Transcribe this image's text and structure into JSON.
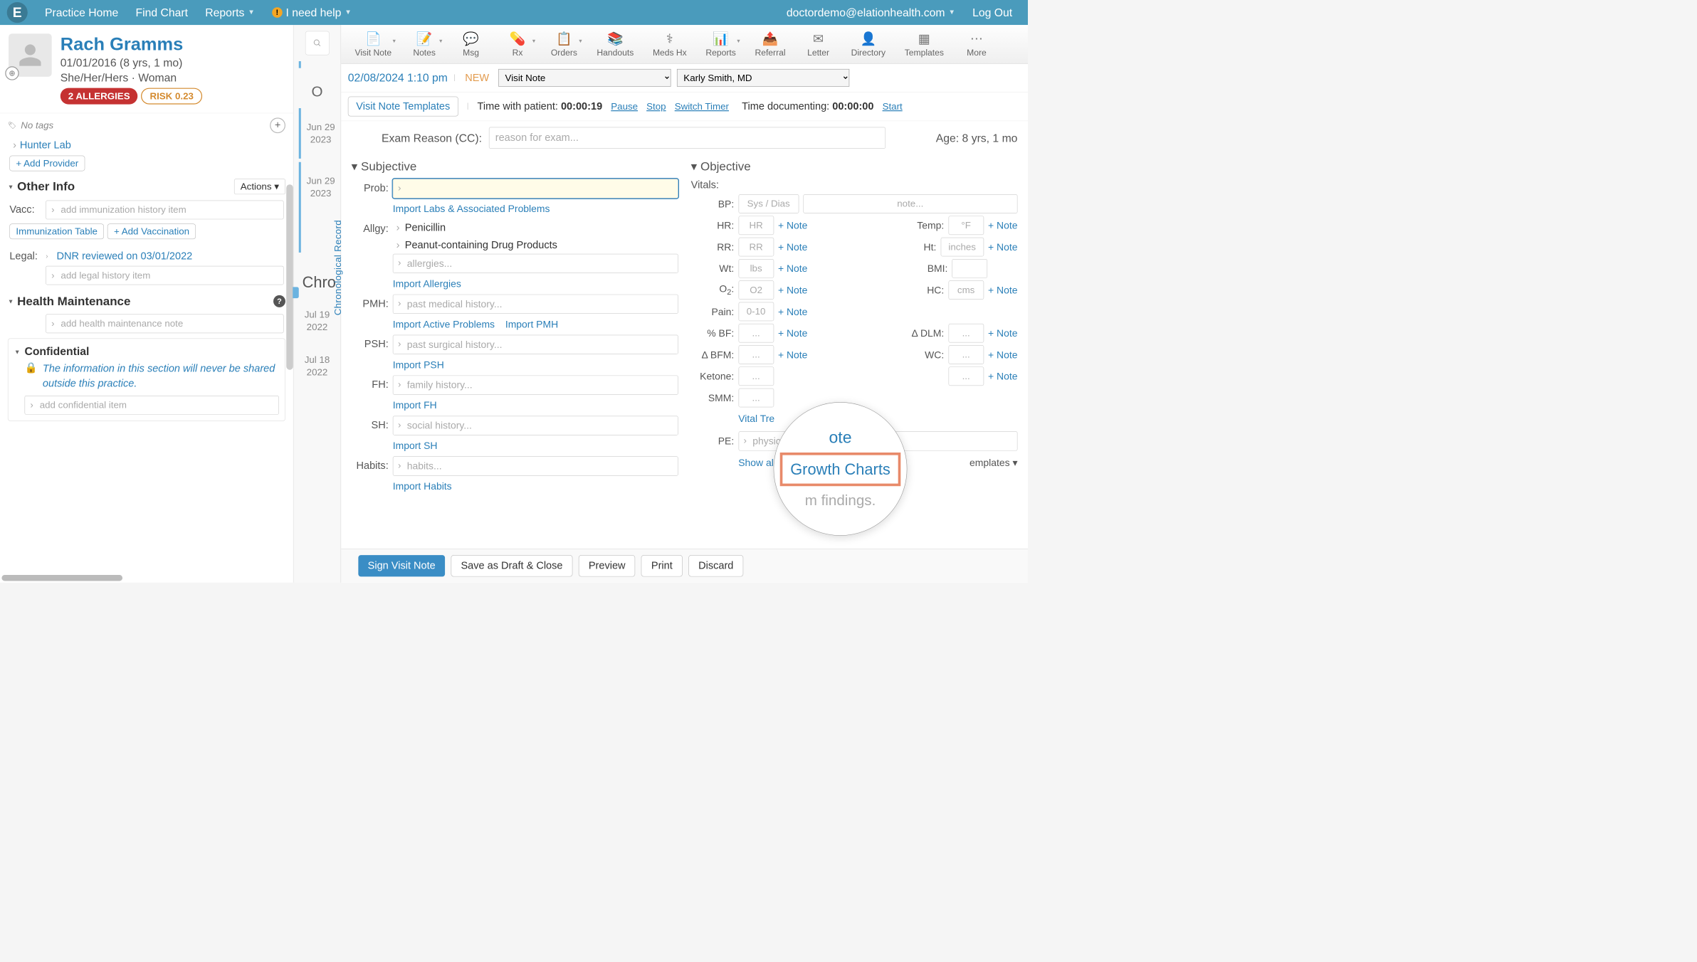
{
  "nav": {
    "practice_home": "Practice Home",
    "find_chart": "Find Chart",
    "reports": "Reports",
    "help": "I need help",
    "user": "doctordemo@elationhealth.com",
    "logout": "Log Out"
  },
  "patient": {
    "name": "Rach Gramms",
    "dob_age": "01/01/2016 (8 yrs, 1 mo)",
    "pronouns": "She/Her/Hers · Woman",
    "allergies_badge": "2 ALLERGIES",
    "risk_badge": "RISK 0.23",
    "no_tags": "No tags"
  },
  "sidebar": {
    "hunter_lab": "Hunter Lab",
    "add_provider": "+ Add Provider",
    "other_info": "Other Info",
    "actions": "Actions",
    "vacc_label": "Vacc:",
    "vacc_placeholder": "add immunization history item",
    "immun_table": "Immunization Table",
    "add_vacc": "+ Add Vaccination",
    "legal_label": "Legal:",
    "dnr": "DNR reviewed on 03/01/2022",
    "legal_placeholder": "add legal history item",
    "health_maint": "Health Maintenance",
    "hm_placeholder": "add health maintenance note",
    "confidential": "Confidential",
    "conf_text": "The information in this section will never be shared outside this practice.",
    "conf_placeholder": "add confidential item"
  },
  "timeline": {
    "header_letter": "O",
    "d1_line1": "Jun 29",
    "d1_line2": "2023",
    "d2_line1": "Jun 29",
    "d2_line2": "2023",
    "chron": "Chro",
    "d3_line1": "Jul 19",
    "d3_line2": "2022",
    "d4_line1": "Jul 18",
    "d4_line2": "2022",
    "vert_label": "Chronological Record"
  },
  "toolbar": {
    "visit_note": "Visit Note",
    "notes": "Notes",
    "msg": "Msg",
    "rx": "Rx",
    "orders": "Orders",
    "handouts": "Handouts",
    "meds_hx": "Meds Hx",
    "reports": "Reports",
    "referral": "Referral",
    "letter": "Letter",
    "directory": "Directory",
    "templates": "Templates",
    "more": "More"
  },
  "note_header": {
    "date": "02/08/2024 1:10 pm",
    "new": "NEW",
    "type": "Visit Note",
    "provider": "Karly Smith, MD",
    "templates_btn": "Visit Note Templates",
    "time_patient_label": "Time with patient:",
    "time_patient_val": "00:00:19",
    "pause": "Pause",
    "stop": "Stop",
    "switch": "Switch Timer",
    "time_doc_label": "Time documenting:",
    "time_doc_val": "00:00:00",
    "start": "Start"
  },
  "exam": {
    "label": "Exam Reason (CC):",
    "placeholder": "reason for exam...",
    "age": "Age: 8 yrs, 1 mo"
  },
  "subjective": {
    "title": "Subjective",
    "prob": "Prob:",
    "import_labs": "Import Labs & Associated Problems",
    "allgy": "Allgy:",
    "allergy1": "Penicillin",
    "allergy2": "Peanut-containing Drug Products",
    "allergy_placeholder": "allergies...",
    "import_allergies": "Import Allergies",
    "pmh": "PMH:",
    "pmh_placeholder": "past medical history...",
    "import_active": "Import Active Problems",
    "import_pmh": "Import PMH",
    "psh": "PSH:",
    "psh_placeholder": "past surgical history...",
    "import_psh": "Import PSH",
    "fh": "FH:",
    "fh_placeholder": "family history...",
    "import_fh": "Import FH",
    "sh": "SH:",
    "sh_placeholder": "social history...",
    "import_sh": "Import SH",
    "habits": "Habits:",
    "habits_placeholder": "habits...",
    "import_habits": "Import Habits"
  },
  "objective": {
    "title": "Objective",
    "vitals": "Vitals:",
    "bp": "BP:",
    "bp_placeholder": "Sys / Dias",
    "note_placeholder": "note...",
    "hr": "HR:",
    "hr_placeholder": "HR",
    "temp": "Temp:",
    "temp_placeholder": "°F",
    "rr": "RR:",
    "rr_placeholder": "RR",
    "ht": "Ht:",
    "ht_placeholder": "inches",
    "wt": "Wt:",
    "wt_placeholder": "lbs",
    "bmi": "BMI:",
    "o2_label": "O",
    "o2_sub": "2",
    "o2_suffix": ":",
    "o2_placeholder": "O2",
    "hc": "HC:",
    "hc_placeholder": "cms",
    "pain": "Pain:",
    "pain_placeholder": "0-10",
    "pbf": "% BF:",
    "dlm": "Δ DLM:",
    "bfm": "Δ BFM:",
    "wc": "WC:",
    "ketone": "Ketone:",
    "smm": "SMM:",
    "dots": "...",
    "add_note": "+ Note",
    "vital_trends": "Vital Tre",
    "growth_charts": "Growth Charts",
    "pe": "PE:",
    "pe_placeholder": "physic",
    "show_all": "Show all che",
    "templates": "emplates",
    "mag_ote": "ote",
    "mag_findings": "m findings."
  },
  "actions": {
    "sign": "Sign Visit Note",
    "save_draft": "Save as Draft & Close",
    "preview": "Preview",
    "print": "Print",
    "discard": "Discard"
  }
}
